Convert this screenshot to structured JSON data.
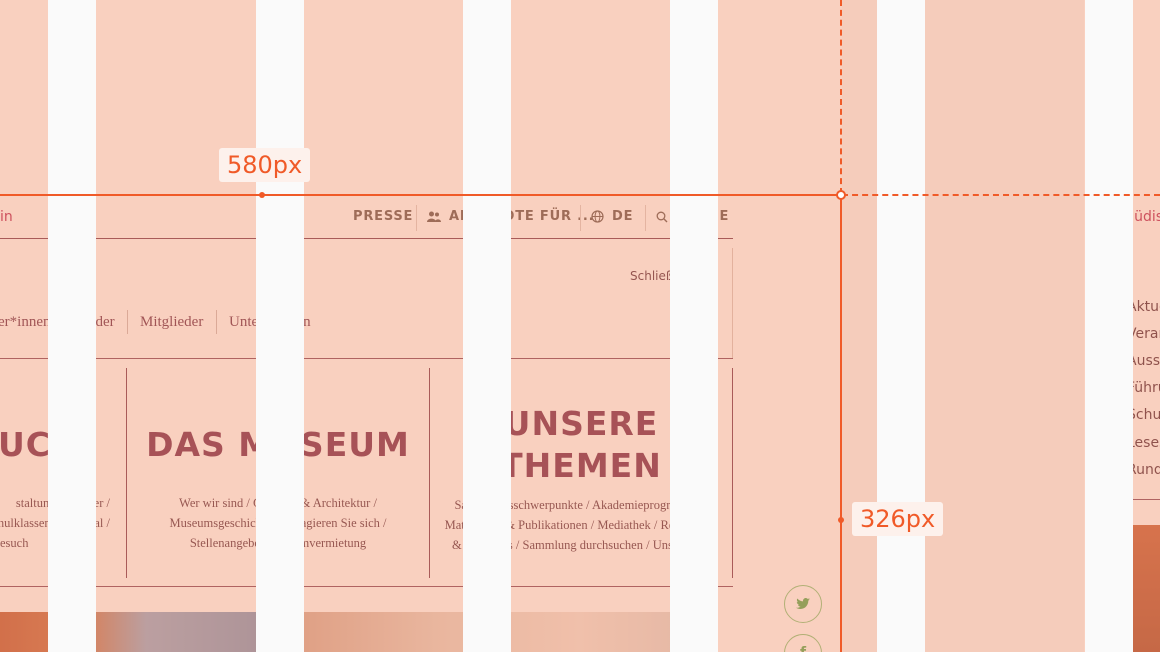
{
  "header": {
    "site_name_fragment": "in",
    "nav": [
      {
        "label": "PRESSE",
        "icon": "none"
      },
      {
        "label": "ANGEBOTE FÜR ...",
        "icon": "people-icon"
      },
      {
        "label": "DE",
        "icon": "globe-icon"
      },
      {
        "label": "SUCHE",
        "icon": "search-icon"
      }
    ]
  },
  "mega_menu": {
    "close_label": "Schließen",
    "audience_tabs": [
      "er*innen",
      "Kinder",
      "Mitglieder",
      "Unternehmen"
    ],
    "columns": [
      {
        "title": "UCH",
        "links_lines": [
          "staltungskalender /",
          "hulklassen / Lesesaal /",
          "esuch"
        ]
      },
      {
        "title": "DAS MUSEUM",
        "links_lines": [
          "Wer wir sind / Gebäude & Architektur /",
          "Museumsgeschichte / Engagieren Sie sich /",
          "Stellenangebote / Raumvermietung"
        ]
      },
      {
        "title_lines": [
          "UNSERE",
          "THEMEN"
        ],
        "links_lines": [
          "Sammlungsschwerpunkte / Akademieprogramme /",
          "Materialien & Publikationen / Mediathek / Recherche-",
          "& Linktipps / Sammlung durchsuchen / Unser Blog"
        ]
      }
    ]
  },
  "social": {
    "twitter": "twitter-icon",
    "facebook": "facebook-icon"
  },
  "side_preview": {
    "title": "Jüdis",
    "items": [
      "Aktue",
      "Veran",
      "Ausst",
      "Führu",
      "Schu",
      "Leses",
      "Rund"
    ]
  },
  "measurements": {
    "width_label": "580px",
    "height_label": "326px"
  },
  "colors": {
    "accent": "#f05a28",
    "brand": "#b0184d",
    "text_dark": "#6a1a42",
    "overlay": "#f29670"
  }
}
